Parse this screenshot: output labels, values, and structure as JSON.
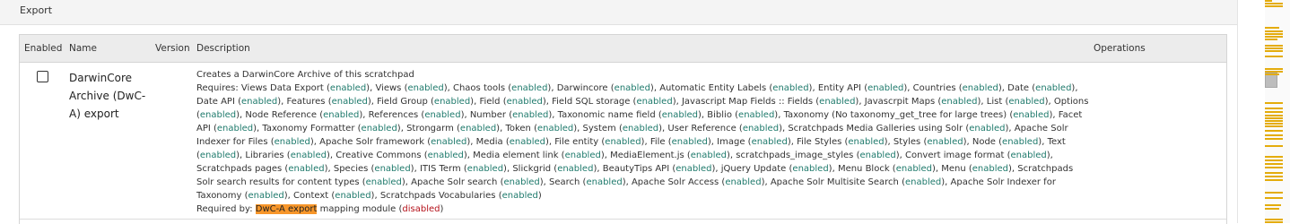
{
  "legend": "Export",
  "table": {
    "headers": {
      "enabled": "Enabled",
      "name": "Name",
      "version": "Version",
      "description": "Description",
      "operations": "Operations"
    },
    "row": {
      "enabled": false,
      "name": "DarwinCore Archive (DwC-A) export",
      "version": "",
      "summary": "Creates a DarwinCore Archive of this scratchpad",
      "requires_label": "Requires:",
      "enabled_word": "enabled",
      "disabled_word": "disabled",
      "requires": [
        "Views Data Export",
        "Views",
        "Chaos tools",
        "Darwincore",
        "Automatic Entity Labels",
        "Entity API",
        "Countries",
        "Date",
        "Date API",
        "Features",
        "Field Group",
        "Field",
        "Field SQL storage",
        "Javascript Map Fields :: Fields",
        "Javascrpit Maps",
        "List",
        "Options",
        "Node Reference",
        "References",
        "Number",
        "Taxonomic name field",
        "Biblio",
        "Taxonomy (No taxonomy_get_tree for large trees)",
        "Facet API",
        "Taxonomy Formatter",
        "Strongarm",
        "Token",
        "System",
        "User Reference",
        "Scratchpads Media Galleries using Solr",
        "Apache Solr Indexer for Files",
        "Apache Solr framework",
        "Media",
        "File entity",
        "File",
        "Image",
        "File Styles",
        "Styles",
        "Node",
        "Text",
        "Libraries",
        "Creative Commons",
        "Media element link",
        "MediaElement.js",
        "scratchpads_image_styles",
        "Convert image format",
        "Scratchpads pages",
        "Species",
        "ITIS Term",
        "Slickgrid",
        "BeautyTips API",
        "jQuery Update",
        "Menu Block",
        "Menu",
        "Scratchpads Solr search results for content types",
        "Apache Solr search",
        "Search",
        "Apache Solr Access",
        "Apache Solr Multisite Search",
        "Apache Solr Indexer for Taxonomy",
        "Context",
        "Scratchpads Vocabularies"
      ],
      "required_by_label": "Required by:",
      "required_by": {
        "name": "DwC-A export",
        "rest": "mapping module"
      }
    }
  },
  "colors": {
    "enabled_text": "#1f7a6c",
    "disabled_text": "#b5121b",
    "highlight": "#f7962a",
    "scroll_marks": "#e4ac0b"
  }
}
